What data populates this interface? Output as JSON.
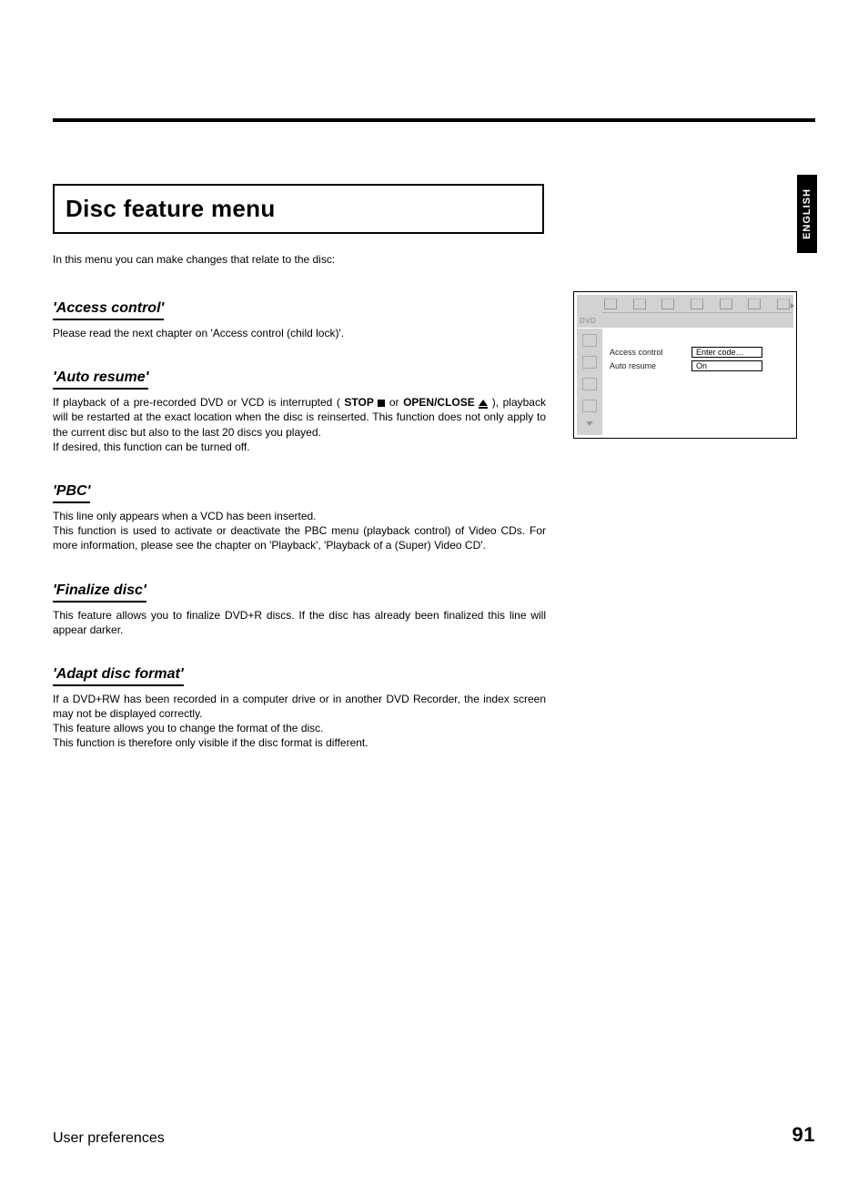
{
  "lang_tab": "ENGLISH",
  "title": "Disc feature menu",
  "intro": "In this menu you can make changes that relate to the disc:",
  "sections": {
    "s0": {
      "head": "'Access control'",
      "body": "Please read the next chapter on 'Access control (child lock)'."
    },
    "s1": {
      "head": "'Auto resume'",
      "p1a": "If playback of a pre-recorded DVD or VCD is interrupted ( ",
      "stop": "STOP",
      "p1b": " or ",
      "open": "OPEN/CLOSE",
      "p1c": " ), playback will be restarted at the exact location when the disc is reinserted. This function does not only apply to the current disc but also to the last 20 discs you played.",
      "p2": "If desired, this function can be turned off."
    },
    "s2": {
      "head": "'PBC'",
      "p1": "This line only appears when a VCD has been inserted.",
      "p2": "This function is used to activate or deactivate the PBC menu (playback control) of Video CDs. For more information, please see the chapter on 'Playback', 'Playback of a (Super) Video CD'."
    },
    "s3": {
      "head": "'Finalize disc'",
      "body": "This feature allows you to finalize DVD+R discs. If the disc has already been finalized this line will appear darker."
    },
    "s4": {
      "head": "'Adapt disc format'",
      "p1": "If a DVD+RW has been recorded in a computer drive or in another DVD Recorder, the index screen may not be displayed correctly.",
      "p2": "This feature allows you to change the format of the disc.",
      "p3": "This function is therefore only visible if the disc format is different."
    }
  },
  "osd": {
    "brand": "DVD",
    "rows": {
      "r0": {
        "label": "Access control",
        "value": "Enter code…"
      },
      "r1": {
        "label": "Auto resume",
        "value": "On"
      }
    }
  },
  "footer": {
    "left": "User preferences",
    "right": "91"
  }
}
